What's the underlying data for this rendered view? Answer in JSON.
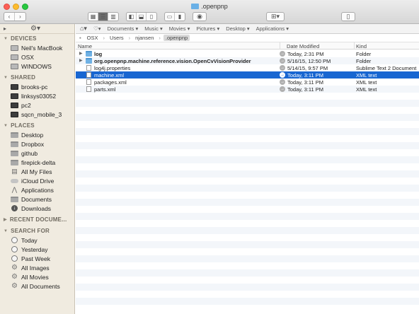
{
  "window": {
    "title": ".openpnp"
  },
  "toolbar": {
    "nav_back": "‹",
    "nav_forward": "›",
    "view_modes": [
      "icon-view",
      "list-view",
      "column-view"
    ],
    "arrange_label": "⊞▾",
    "share_label": "▯"
  },
  "favorites_bar": {
    "items": [
      "Documents",
      "Music",
      "Movies",
      "Pictures",
      "Desktop",
      "Applications"
    ]
  },
  "path": [
    "OSX",
    "Users",
    "njansen",
    ".openpnp"
  ],
  "sidebar": {
    "sections": [
      {
        "title": "DEVICES",
        "items": [
          {
            "label": "Neil's MacBook",
            "icon": "laptop-icon"
          },
          {
            "label": "OSX",
            "icon": "drive-icon"
          },
          {
            "label": "WINDOWS",
            "icon": "drive-icon"
          }
        ]
      },
      {
        "title": "SHARED",
        "items": [
          {
            "label": "brooks-pc",
            "icon": "computer-icon"
          },
          {
            "label": "linksys03052",
            "icon": "computer-icon"
          },
          {
            "label": "pc2",
            "icon": "computer-icon"
          },
          {
            "label": "sqcn_mobile_3",
            "icon": "computer-icon"
          }
        ]
      },
      {
        "title": "PLACES",
        "items": [
          {
            "label": "Desktop",
            "icon": "folder-icon"
          },
          {
            "label": "Dropbox",
            "icon": "folder-icon"
          },
          {
            "label": "github",
            "icon": "folder-icon"
          },
          {
            "label": "firepick-delta",
            "icon": "folder-icon"
          },
          {
            "label": "All My Files",
            "icon": "all-files-icon"
          },
          {
            "label": "iCloud Drive",
            "icon": "cloud-icon"
          },
          {
            "label": "Applications",
            "icon": "applications-icon"
          },
          {
            "label": "Documents",
            "icon": "documents-icon"
          },
          {
            "label": "Downloads",
            "icon": "downloads-icon"
          }
        ]
      },
      {
        "title": "RECENT DOCUME...",
        "collapsed": true,
        "items": []
      },
      {
        "title": "SEARCH FOR",
        "items": [
          {
            "label": "Today",
            "icon": "clock-icon"
          },
          {
            "label": "Yesterday",
            "icon": "clock-icon"
          },
          {
            "label": "Past Week",
            "icon": "clock-icon"
          },
          {
            "label": "All Images",
            "icon": "gear-icon"
          },
          {
            "label": "All Movies",
            "icon": "gear-icon"
          },
          {
            "label": "All Documents",
            "icon": "gear-icon"
          }
        ]
      }
    ]
  },
  "columns": {
    "name": "Name",
    "date": "Date Modified",
    "kind": "Kind"
  },
  "files": [
    {
      "name": "log",
      "date": "Today, 2:31 PM",
      "kind": "Folder",
      "type": "folder",
      "expandable": true,
      "bold": true,
      "selected": false
    },
    {
      "name": "org.openpnp.machine.reference.vision.OpenCvVisionProvider",
      "date": "5/16/15, 12:50 PM",
      "kind": "Folder",
      "type": "folder",
      "expandable": true,
      "bold": true,
      "selected": false
    },
    {
      "name": "log4j.properties",
      "date": "5/14/15, 9:57 PM",
      "kind": "Sublime Text 2 Document",
      "type": "doc",
      "expandable": false,
      "bold": false,
      "selected": false
    },
    {
      "name": "machine.xml",
      "date": "Today, 3:11 PM",
      "kind": "XML text",
      "type": "doc",
      "expandable": false,
      "bold": false,
      "selected": true
    },
    {
      "name": "packages.xml",
      "date": "Today, 3:11 PM",
      "kind": "XML text",
      "type": "doc",
      "expandable": false,
      "bold": false,
      "selected": false
    },
    {
      "name": "parts.xml",
      "date": "Today, 3:11 PM",
      "kind": "XML text",
      "type": "doc",
      "expandable": false,
      "bold": false,
      "selected": false
    }
  ],
  "colors": {
    "selection": "#1866d1",
    "sidebar_bg": "#f0ebe0",
    "folder": "#6fb1e4"
  }
}
